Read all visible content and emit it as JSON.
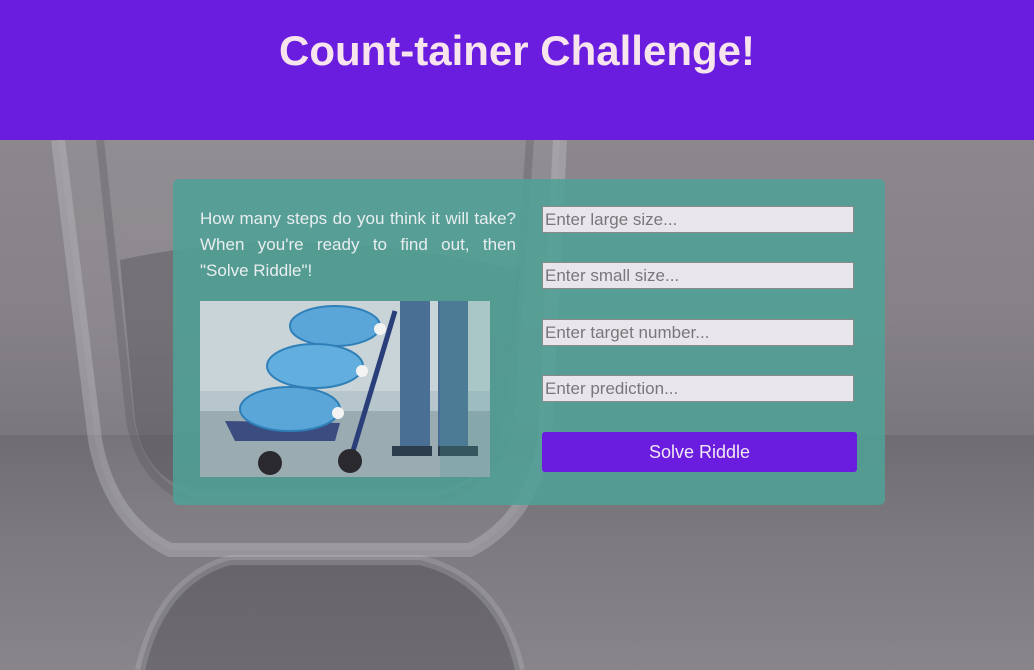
{
  "header": {
    "title": "Count-tainer Challenge!"
  },
  "card": {
    "riddle_text": "How many steps do you think it will take? When you're ready to find out, then \"Solve Riddle\"!",
    "image_alt": "Worker moving water jugs on a hand truck",
    "fields": {
      "large_placeholder": "Enter large size...",
      "small_placeholder": "Enter small size...",
      "target_placeholder": "Enter target number...",
      "prediction_placeholder": "Enter prediction..."
    },
    "solve_label": "Solve Riddle"
  },
  "colors": {
    "header_bg": "#6b1ddf",
    "title_color": "#f7e4ec",
    "card_bg": "#50a096",
    "button_bg": "#6b1ddf"
  }
}
